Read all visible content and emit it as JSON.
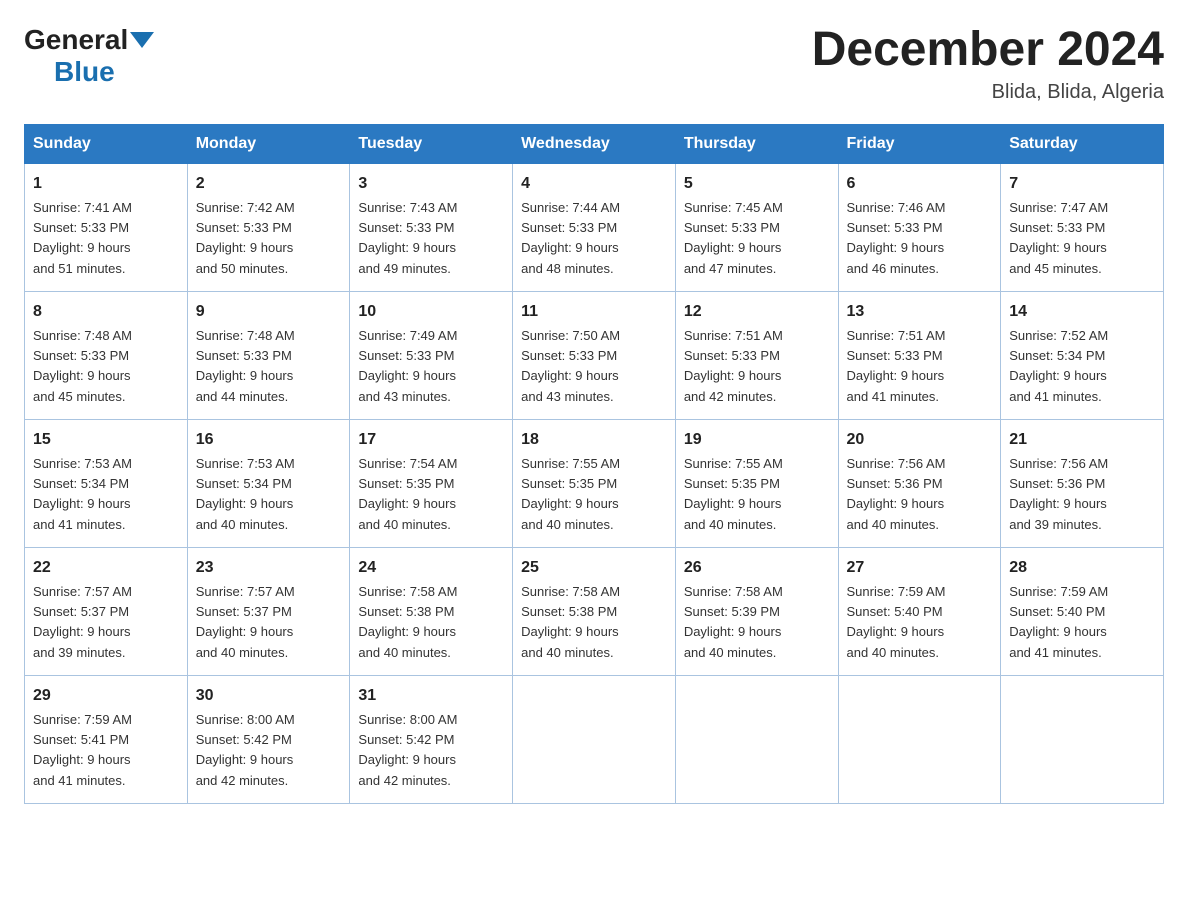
{
  "header": {
    "title": "December 2024",
    "subtitle": "Blida, Blida, Algeria",
    "logo_general": "General",
    "logo_blue": "Blue"
  },
  "columns": [
    "Sunday",
    "Monday",
    "Tuesday",
    "Wednesday",
    "Thursday",
    "Friday",
    "Saturday"
  ],
  "weeks": [
    [
      {
        "day": "1",
        "sunrise": "7:41 AM",
        "sunset": "5:33 PM",
        "daylight": "9 hours and 51 minutes."
      },
      {
        "day": "2",
        "sunrise": "7:42 AM",
        "sunset": "5:33 PM",
        "daylight": "9 hours and 50 minutes."
      },
      {
        "day": "3",
        "sunrise": "7:43 AM",
        "sunset": "5:33 PM",
        "daylight": "9 hours and 49 minutes."
      },
      {
        "day": "4",
        "sunrise": "7:44 AM",
        "sunset": "5:33 PM",
        "daylight": "9 hours and 48 minutes."
      },
      {
        "day": "5",
        "sunrise": "7:45 AM",
        "sunset": "5:33 PM",
        "daylight": "9 hours and 47 minutes."
      },
      {
        "day": "6",
        "sunrise": "7:46 AM",
        "sunset": "5:33 PM",
        "daylight": "9 hours and 46 minutes."
      },
      {
        "day": "7",
        "sunrise": "7:47 AM",
        "sunset": "5:33 PM",
        "daylight": "9 hours and 45 minutes."
      }
    ],
    [
      {
        "day": "8",
        "sunrise": "7:48 AM",
        "sunset": "5:33 PM",
        "daylight": "9 hours and 45 minutes."
      },
      {
        "day": "9",
        "sunrise": "7:48 AM",
        "sunset": "5:33 PM",
        "daylight": "9 hours and 44 minutes."
      },
      {
        "day": "10",
        "sunrise": "7:49 AM",
        "sunset": "5:33 PM",
        "daylight": "9 hours and 43 minutes."
      },
      {
        "day": "11",
        "sunrise": "7:50 AM",
        "sunset": "5:33 PM",
        "daylight": "9 hours and 43 minutes."
      },
      {
        "day": "12",
        "sunrise": "7:51 AM",
        "sunset": "5:33 PM",
        "daylight": "9 hours and 42 minutes."
      },
      {
        "day": "13",
        "sunrise": "7:51 AM",
        "sunset": "5:33 PM",
        "daylight": "9 hours and 41 minutes."
      },
      {
        "day": "14",
        "sunrise": "7:52 AM",
        "sunset": "5:34 PM",
        "daylight": "9 hours and 41 minutes."
      }
    ],
    [
      {
        "day": "15",
        "sunrise": "7:53 AM",
        "sunset": "5:34 PM",
        "daylight": "9 hours and 41 minutes."
      },
      {
        "day": "16",
        "sunrise": "7:53 AM",
        "sunset": "5:34 PM",
        "daylight": "9 hours and 40 minutes."
      },
      {
        "day": "17",
        "sunrise": "7:54 AM",
        "sunset": "5:35 PM",
        "daylight": "9 hours and 40 minutes."
      },
      {
        "day": "18",
        "sunrise": "7:55 AM",
        "sunset": "5:35 PM",
        "daylight": "9 hours and 40 minutes."
      },
      {
        "day": "19",
        "sunrise": "7:55 AM",
        "sunset": "5:35 PM",
        "daylight": "9 hours and 40 minutes."
      },
      {
        "day": "20",
        "sunrise": "7:56 AM",
        "sunset": "5:36 PM",
        "daylight": "9 hours and 40 minutes."
      },
      {
        "day": "21",
        "sunrise": "7:56 AM",
        "sunset": "5:36 PM",
        "daylight": "9 hours and 39 minutes."
      }
    ],
    [
      {
        "day": "22",
        "sunrise": "7:57 AM",
        "sunset": "5:37 PM",
        "daylight": "9 hours and 39 minutes."
      },
      {
        "day": "23",
        "sunrise": "7:57 AM",
        "sunset": "5:37 PM",
        "daylight": "9 hours and 40 minutes."
      },
      {
        "day": "24",
        "sunrise": "7:58 AM",
        "sunset": "5:38 PM",
        "daylight": "9 hours and 40 minutes."
      },
      {
        "day": "25",
        "sunrise": "7:58 AM",
        "sunset": "5:38 PM",
        "daylight": "9 hours and 40 minutes."
      },
      {
        "day": "26",
        "sunrise": "7:58 AM",
        "sunset": "5:39 PM",
        "daylight": "9 hours and 40 minutes."
      },
      {
        "day": "27",
        "sunrise": "7:59 AM",
        "sunset": "5:40 PM",
        "daylight": "9 hours and 40 minutes."
      },
      {
        "day": "28",
        "sunrise": "7:59 AM",
        "sunset": "5:40 PM",
        "daylight": "9 hours and 41 minutes."
      }
    ],
    [
      {
        "day": "29",
        "sunrise": "7:59 AM",
        "sunset": "5:41 PM",
        "daylight": "9 hours and 41 minutes."
      },
      {
        "day": "30",
        "sunrise": "8:00 AM",
        "sunset": "5:42 PM",
        "daylight": "9 hours and 42 minutes."
      },
      {
        "day": "31",
        "sunrise": "8:00 AM",
        "sunset": "5:42 PM",
        "daylight": "9 hours and 42 minutes."
      },
      {
        "day": "",
        "sunrise": "",
        "sunset": "",
        "daylight": ""
      },
      {
        "day": "",
        "sunrise": "",
        "sunset": "",
        "daylight": ""
      },
      {
        "day": "",
        "sunrise": "",
        "sunset": "",
        "daylight": ""
      },
      {
        "day": "",
        "sunrise": "",
        "sunset": "",
        "daylight": ""
      }
    ]
  ],
  "labels": {
    "sunrise": "Sunrise:",
    "sunset": "Sunset:",
    "daylight": "Daylight:"
  }
}
